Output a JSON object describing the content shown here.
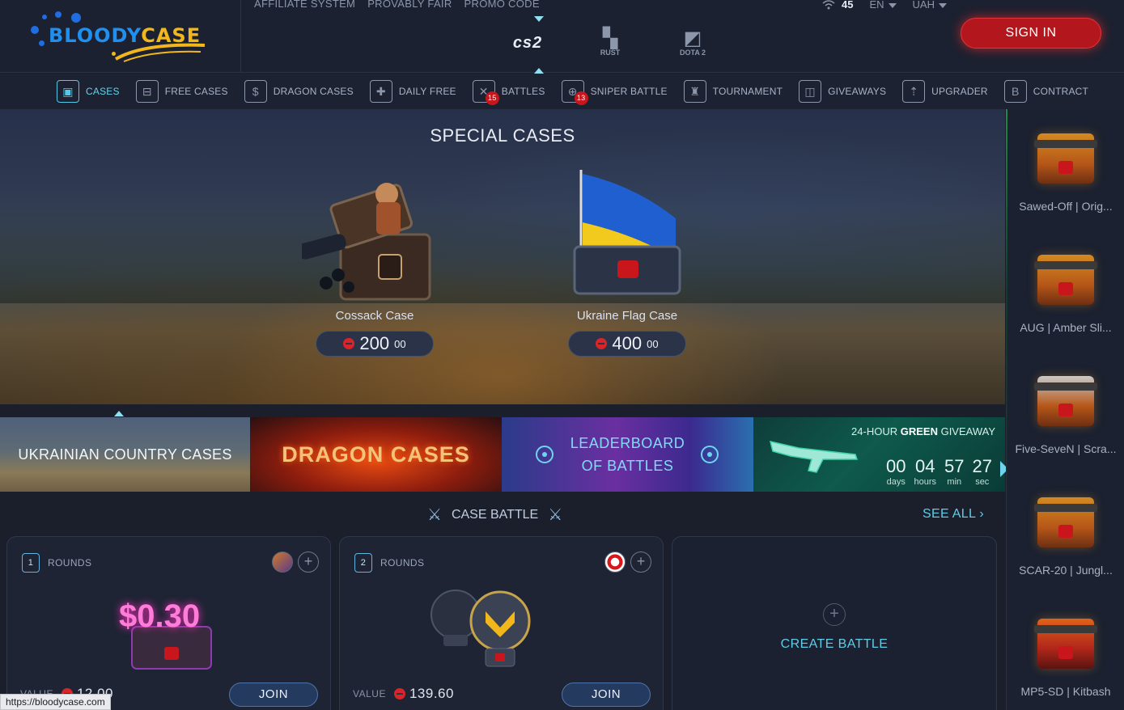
{
  "header": {
    "logo_text_a": "BLOODY",
    "logo_text_b": "CASE",
    "topnav": [
      "AFFILIATE SYSTEM",
      "PROVABLY FAIR",
      "PROMO CODE"
    ],
    "games": [
      "cs2",
      "RUST",
      "DOTA 2"
    ],
    "online_count": "45",
    "language": "EN",
    "currency": "UAH",
    "signin_label": "SIGN IN"
  },
  "catnav": [
    {
      "label": "CASES",
      "icon": "chest-icon",
      "active": true
    },
    {
      "label": "FREE CASES",
      "icon": "gift-case-icon"
    },
    {
      "label": "DRAGON CASES",
      "icon": "dragon-case-icon"
    },
    {
      "label": "DAILY FREE",
      "icon": "daily-gift-icon"
    },
    {
      "label": "BATTLES",
      "icon": "crossed-swords-icon",
      "badge": "15"
    },
    {
      "label": "SNIPER BATTLE",
      "icon": "crosshair-icon",
      "badge": "13"
    },
    {
      "label": "TOURNAMENT",
      "icon": "trophy-icon"
    },
    {
      "label": "GIVEAWAYS",
      "icon": "cards-icon"
    },
    {
      "label": "UPGRADER",
      "icon": "upgrade-icon"
    },
    {
      "label": "CONTRACT",
      "icon": "contract-icon"
    }
  ],
  "hero": {
    "title": "SPECIAL CASES",
    "cases": [
      {
        "name": "Cossack Case",
        "price_int": "200",
        "price_dec": "00"
      },
      {
        "name": "Ukraine Flag Case",
        "price_int": "400",
        "price_dec": "00"
      }
    ]
  },
  "banners": {
    "ukrainian": "UKRAINIAN COUNTRY CASES",
    "dragon": "DRAGON CASES",
    "leaderboard_line1": "LEADERBOARD",
    "leaderboard_line2": "OF BATTLES",
    "giveaway_prefix": "24-HOUR ",
    "giveaway_bold": "GREEN",
    "giveaway_suffix": " GIVEAWAY",
    "countdown": [
      {
        "value": "00",
        "label": "days"
      },
      {
        "value": "04",
        "label": "hours"
      },
      {
        "value": "57",
        "label": "min"
      },
      {
        "value": "27",
        "label": "sec"
      }
    ]
  },
  "battle": {
    "title": "CASE BATTLE",
    "see_all": "SEE ALL",
    "cards": [
      {
        "rounds": "1",
        "rounds_label": "ROUNDS",
        "value_label": "VALUE",
        "value": "12.00",
        "join": "JOIN",
        "promo": "$0.30"
      },
      {
        "rounds": "2",
        "rounds_label": "ROUNDS",
        "value_label": "VALUE",
        "value": "139.60",
        "join": "JOIN"
      }
    ],
    "create_label": "CREATE BATTLE"
  },
  "live_drops": [
    {
      "name": "Sawed-Off | Orig..."
    },
    {
      "name": "AUG | Amber Sli..."
    },
    {
      "name": "Five-SeveN | Scra..."
    },
    {
      "name": "SCAR-20 | Jungl..."
    },
    {
      "name": "MP5-SD | Kitbash"
    }
  ],
  "statusbar": "https://bloodycase.com",
  "colors": {
    "accent": "#5fcde6",
    "brand_red": "#c8161c",
    "bg": "#1a1f2b"
  }
}
